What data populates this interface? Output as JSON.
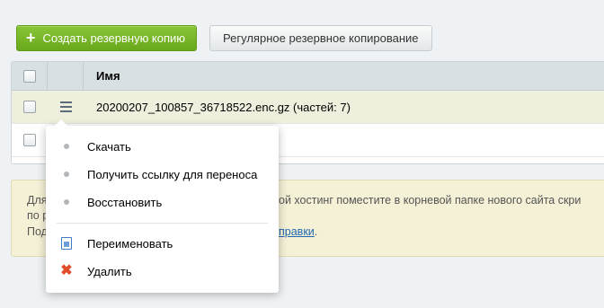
{
  "toolbar": {
    "create_label": "Создать резервную копию",
    "regular_label": "Регулярное резервное копирование"
  },
  "grid": {
    "header_name": "Имя",
    "rows": [
      {
        "name": "20200207_100857_36718522.enc.gz (частей: 7)",
        "selected": true
      },
      {
        "name": "",
        "selected": false
      }
    ]
  },
  "info": {
    "line1_start": "Для",
    "line1_end": "ой хостинг поместите в корневой папке нового сайта скри",
    "line2": "по р",
    "line3_start": "Под",
    "line3_link": "правки",
    "line3_end": "."
  },
  "context_menu": {
    "items": [
      {
        "label": "Скачать",
        "icon": "dot-icon"
      },
      {
        "label": "Получить ссылку для переноса",
        "icon": "dot-icon"
      },
      {
        "label": "Восстановить",
        "icon": "dot-icon"
      },
      {
        "label": "Переименовать",
        "icon": "rename-icon"
      },
      {
        "label": "Удалить",
        "icon": "delete-icon"
      }
    ]
  },
  "colors": {
    "accent_green": "#7ab828",
    "selected_row": "#eef0dd",
    "info_bg": "#f5f1d7",
    "link": "#2067b0",
    "delete": "#e04b2a"
  }
}
